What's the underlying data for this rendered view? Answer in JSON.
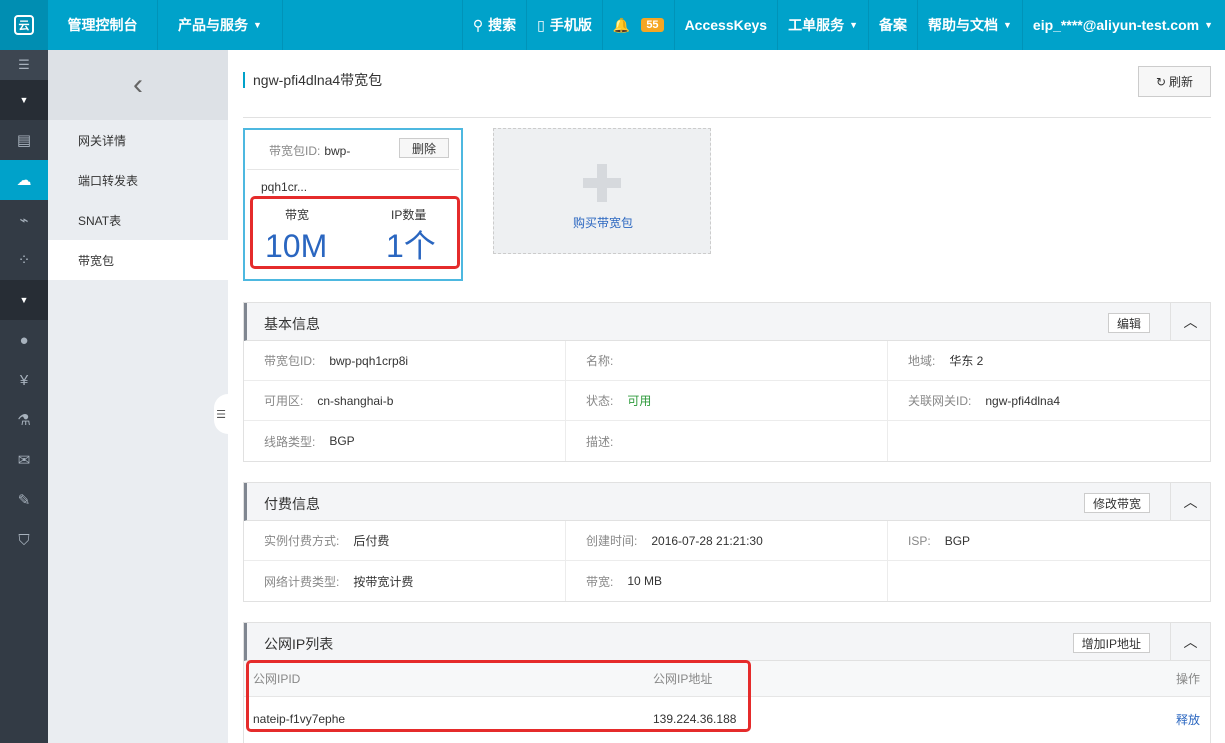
{
  "topbar": {
    "logo_glyph": "云",
    "console": "管理控制台",
    "products": "产品与服务",
    "search": "搜索",
    "mobile": "手机版",
    "notifications_count": "55",
    "accesskeys": "AccessKeys",
    "ticket": "工单服务",
    "record": "备案",
    "help": "帮助与文档",
    "account": "eip_****@aliyun-test.com"
  },
  "iconbar": {
    "items": [
      "menu-icon",
      "caret-icon",
      "server-icon",
      "cloud-icon",
      "satellite-icon",
      "network-icon",
      "caret-icon",
      "user-icon",
      "yen-icon",
      "flask-icon",
      "mail-icon",
      "pencil-icon",
      "shield-icon"
    ]
  },
  "subnav": {
    "items": [
      "网关详情",
      "端口转发表",
      "SNAT表",
      "带宽包"
    ],
    "active_index": 3
  },
  "page": {
    "title": "ngw-pfi4dlna4带宽包",
    "refresh": "刷新"
  },
  "bandwidth_card": {
    "id_label": "带宽包ID:",
    "id_value_part1": "bwp-",
    "id_value_part2": "pqh1cr...",
    "delete": "删除",
    "bandwidth_label": "带宽",
    "bandwidth_value": "10M",
    "ip_count_label": "IP数量",
    "ip_count_value": "1个"
  },
  "buy_card": {
    "label": "购买带宽包"
  },
  "basic_info": {
    "title": "基本信息",
    "edit": "编辑",
    "rows": [
      [
        {
          "label": "带宽包ID:",
          "value": "bwp-pqh1crp8i"
        },
        {
          "label": "名称:",
          "value": ""
        },
        {
          "label": "地域:",
          "value": "华东 2"
        }
      ],
      [
        {
          "label": "可用区:",
          "value": "cn-shanghai-b"
        },
        {
          "label": "状态:",
          "value": "可用"
        },
        {
          "label": "关联网关ID:",
          "value": "ngw-pfi4dlna4"
        }
      ],
      [
        {
          "label": "线路类型:",
          "value": "BGP"
        },
        {
          "label": "描述:",
          "value": ""
        },
        {
          "label": "",
          "value": ""
        }
      ]
    ]
  },
  "billing_info": {
    "title": "付费信息",
    "modify": "修改带宽",
    "rows": [
      [
        {
          "label": "实例付费方式:",
          "value": "后付费"
        },
        {
          "label": "创建时间:",
          "value": "2016-07-28 21:21:30"
        },
        {
          "label": "ISP:",
          "value": "BGP"
        }
      ],
      [
        {
          "label": "网络计费类型:",
          "value": "按带宽计费"
        },
        {
          "label": "带宽:",
          "value": "10 MB"
        },
        {
          "label": "",
          "value": ""
        }
      ]
    ]
  },
  "ip_list": {
    "title": "公网IP列表",
    "add": "增加IP地址",
    "columns": [
      "公网IPID",
      "公网IP地址",
      "操作"
    ],
    "rows": [
      {
        "id": "nateip-f1vy7ephe",
        "ip": "139.224.36.188",
        "action": "释放"
      }
    ]
  },
  "colors": {
    "topbar": "#00a2ca",
    "sidebar": "#333b45",
    "accent_blue": "#2a66c0",
    "highlight_red": "#e52b2b",
    "status_green": "#2e9a3b"
  }
}
